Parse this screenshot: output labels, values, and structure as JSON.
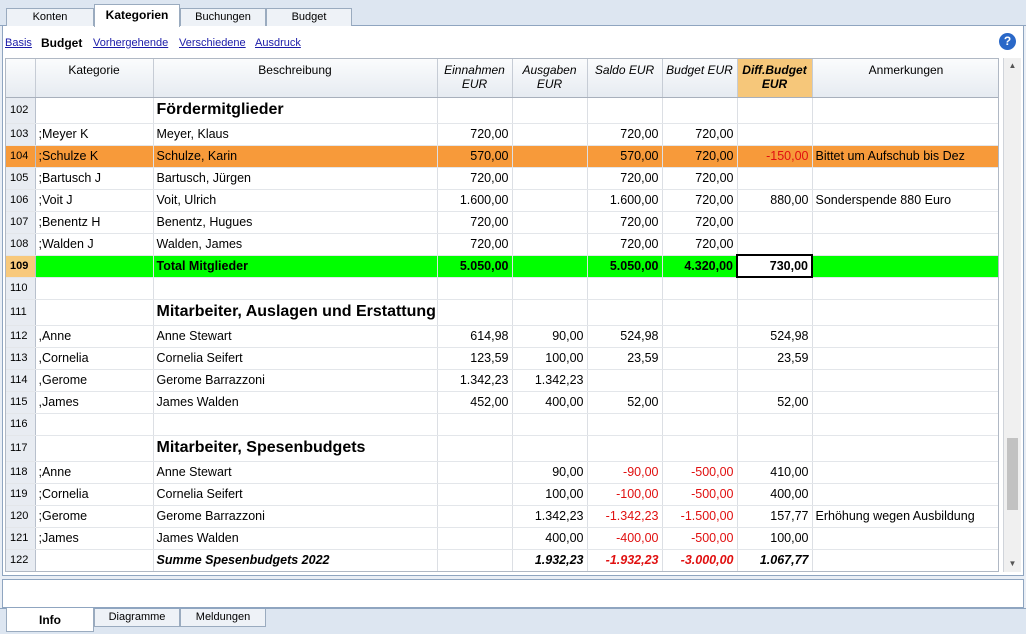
{
  "top_tabs": [
    {
      "label": "Konten"
    },
    {
      "label": "Kategorien"
    },
    {
      "label": "Buchungen"
    },
    {
      "label": "Budget"
    }
  ],
  "subnav": {
    "basis": "Basis",
    "budget": "Budget",
    "vorhergehende": "Vorhergehende",
    "verschiedene": "Verschiedene",
    "ausdruck": "Ausdruck",
    "help": "?"
  },
  "columns": {
    "kategorie": "Kategorie",
    "beschreibung": "Beschreibung",
    "einnahmen": "Einnahmen\nEUR",
    "ausgaben": "Ausgaben\nEUR",
    "saldo": "Saldo EUR",
    "budget": "Budget EUR",
    "diff": "Diff.Budget\nEUR",
    "anmerkungen": "Anmerkungen"
  },
  "rows": [
    {
      "n": "102",
      "kat": "",
      "desc": "Fördermitglieder",
      "ein": "",
      "aus": "",
      "saldo": "",
      "budget": "",
      "diff": "",
      "anm": ""
    },
    {
      "n": "103",
      "kat": ";Meyer K",
      "desc": "Meyer, Klaus",
      "ein": "720,00",
      "aus": "",
      "saldo": "720,00",
      "budget": "720,00",
      "diff": "",
      "anm": ""
    },
    {
      "n": "104",
      "kat": ";Schulze K",
      "desc": "Schulze, Karin",
      "ein": "570,00",
      "aus": "",
      "saldo": "570,00",
      "budget": "720,00",
      "diff": "-150,00",
      "anm": "Bittet um Aufschub bis Dez"
    },
    {
      "n": "105",
      "kat": ";Bartusch J",
      "desc": "Bartusch, Jürgen",
      "ein": "720,00",
      "aus": "",
      "saldo": "720,00",
      "budget": "720,00",
      "diff": "",
      "anm": ""
    },
    {
      "n": "106",
      "kat": ";Voit J",
      "desc": "Voit, Ulrich",
      "ein": "1.600,00",
      "aus": "",
      "saldo": "1.600,00",
      "budget": "720,00",
      "diff": "880,00",
      "anm": "Sonderspende 880 Euro"
    },
    {
      "n": "107",
      "kat": ";Benentz H",
      "desc": "Benentz, Hugues",
      "ein": "720,00",
      "aus": "",
      "saldo": "720,00",
      "budget": "720,00",
      "diff": "",
      "anm": ""
    },
    {
      "n": "108",
      "kat": ";Walden J",
      "desc": "Walden, James",
      "ein": "720,00",
      "aus": "",
      "saldo": "720,00",
      "budget": "720,00",
      "diff": "",
      "anm": ""
    },
    {
      "n": "109",
      "kat": "",
      "desc": "Total Mitglieder",
      "ein": "5.050,00",
      "aus": "",
      "saldo": "5.050,00",
      "budget": "4.320,00",
      "diff": "730,00",
      "anm": ""
    },
    {
      "n": "110",
      "kat": "",
      "desc": "",
      "ein": "",
      "aus": "",
      "saldo": "",
      "budget": "",
      "diff": "",
      "anm": ""
    },
    {
      "n": "111",
      "kat": "",
      "desc": "Mitarbeiter, Auslagen und Erstattung",
      "ein": "",
      "aus": "",
      "saldo": "",
      "budget": "",
      "diff": "",
      "anm": ""
    },
    {
      "n": "112",
      "kat": ",Anne",
      "desc": "Anne Stewart",
      "ein": "614,98",
      "aus": "90,00",
      "saldo": "524,98",
      "budget": "",
      "diff": "524,98",
      "anm": ""
    },
    {
      "n": "113",
      "kat": ",Cornelia",
      "desc": "Cornelia Seifert",
      "ein": "123,59",
      "aus": "100,00",
      "saldo": "23,59",
      "budget": "",
      "diff": "23,59",
      "anm": ""
    },
    {
      "n": "114",
      "kat": ",Gerome",
      "desc": "Gerome Barrazzoni",
      "ein": "1.342,23",
      "aus": "1.342,23",
      "saldo": "",
      "budget": "",
      "diff": "",
      "anm": ""
    },
    {
      "n": "115",
      "kat": ",James",
      "desc": "James Walden",
      "ein": "452,00",
      "aus": "400,00",
      "saldo": "52,00",
      "budget": "",
      "diff": "52,00",
      "anm": ""
    },
    {
      "n": "116",
      "kat": "",
      "desc": "",
      "ein": "",
      "aus": "",
      "saldo": "",
      "budget": "",
      "diff": "",
      "anm": ""
    },
    {
      "n": "117",
      "kat": "",
      "desc": "Mitarbeiter, Spesenbudgets",
      "ein": "",
      "aus": "",
      "saldo": "",
      "budget": "",
      "diff": "",
      "anm": ""
    },
    {
      "n": "118",
      "kat": ";Anne",
      "desc": "Anne Stewart",
      "ein": "",
      "aus": "90,00",
      "saldo": "-90,00",
      "budget": "-500,00",
      "diff": "410,00",
      "anm": ""
    },
    {
      "n": "119",
      "kat": ";Cornelia",
      "desc": "Cornelia Seifert",
      "ein": "",
      "aus": "100,00",
      "saldo": "-100,00",
      "budget": "-500,00",
      "diff": "400,00",
      "anm": ""
    },
    {
      "n": "120",
      "kat": ";Gerome",
      "desc": "Gerome Barrazzoni",
      "ein": "",
      "aus": "1.342,23",
      "saldo": "-1.342,23",
      "budget": "-1.500,00",
      "diff": "157,77",
      "anm": "Erhöhung wegen Ausbildung"
    },
    {
      "n": "121",
      "kat": ";James",
      "desc": "James Walden",
      "ein": "",
      "aus": "400,00",
      "saldo": "-400,00",
      "budget": "-500,00",
      "diff": "100,00",
      "anm": ""
    },
    {
      "n": "122",
      "kat": "",
      "desc": "Summe Spesenbudgets 2022",
      "ein": "",
      "aus": "1.932,23",
      "saldo": "-1.932,23",
      "budget": "-3.000,00",
      "diff": "1.067,77",
      "anm": ""
    }
  ],
  "bottom_tabs": [
    {
      "label": "Info"
    },
    {
      "label": "Diagramme"
    },
    {
      "label": "Meldungen"
    }
  ],
  "colors": {
    "selected_row": "#f79a3a",
    "total_row": "#00ff00",
    "negative": "#e01010",
    "highlight_header": "#f6c77a"
  }
}
